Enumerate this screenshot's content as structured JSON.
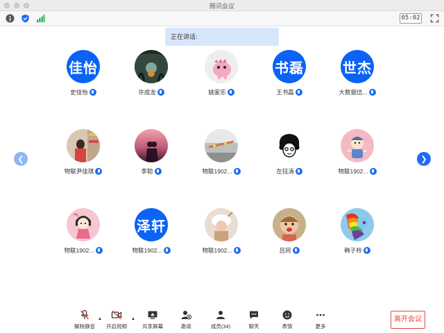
{
  "window": {
    "title": "腾讯会议"
  },
  "toolbar": {
    "info_icon": "info-icon",
    "shield_icon": "shield-icon",
    "signal_icon": "signal-icon",
    "timer": "05:02",
    "fullscreen_icon": "fullscreen-icon"
  },
  "speaking": {
    "label": "正在讲话:"
  },
  "participants": [
    {
      "name": "史佳怡",
      "avatar_text": "佳怡",
      "avatar_kind": "text"
    },
    {
      "name": "许成龙",
      "avatar_text": "",
      "avatar_kind": "forest-orb-photo"
    },
    {
      "name": "姚家乐",
      "avatar_text": "",
      "avatar_kind": "pink-dino-photo"
    },
    {
      "name": "王书磊",
      "avatar_text": "书磊",
      "avatar_kind": "text"
    },
    {
      "name": "大数据信...",
      "avatar_text": "世杰",
      "avatar_kind": "text"
    },
    {
      "name": "物联尹佳琪",
      "avatar_text": "",
      "avatar_kind": "girl-shop-photo"
    },
    {
      "name": "李聪",
      "avatar_text": "",
      "avatar_kind": "sunset-couple-photo"
    },
    {
      "name": "物联1902...",
      "avatar_text": "",
      "avatar_kind": "room-photo"
    },
    {
      "name": "左钰涛",
      "avatar_text": "",
      "avatar_kind": "curly-sketch"
    },
    {
      "name": "物联1902...",
      "avatar_text": "",
      "avatar_kind": "cartoon-boy"
    },
    {
      "name": "物联1902...",
      "avatar_text": "",
      "avatar_kind": "cartoon-girl"
    },
    {
      "name": "物联1902...",
      "avatar_text": "泽轩",
      "avatar_kind": "text"
    },
    {
      "name": "物联1902...",
      "avatar_text": "",
      "avatar_kind": "white-hat-photo"
    },
    {
      "name": "吕珂",
      "avatar_text": "",
      "avatar_kind": "baby-photo"
    },
    {
      "name": "韩子柃",
      "avatar_text": "",
      "avatar_kind": "rainbow-pony"
    }
  ],
  "nav": {
    "prev_icon": "chevron-left-icon",
    "next_icon": "chevron-right-icon"
  },
  "controls": {
    "mute": "解除静音",
    "video": "开启视频",
    "share": "共享屏幕",
    "invite": "邀请",
    "members": "成员(34)",
    "chat": "聊天",
    "emoji": "表情",
    "more": "更多",
    "leave": "离开会议"
  },
  "colors": {
    "accent": "#1f6cf2",
    "avatar_blue": "#0b62f5",
    "leave_red": "#e8433b",
    "banner": "#d7e7fb"
  }
}
